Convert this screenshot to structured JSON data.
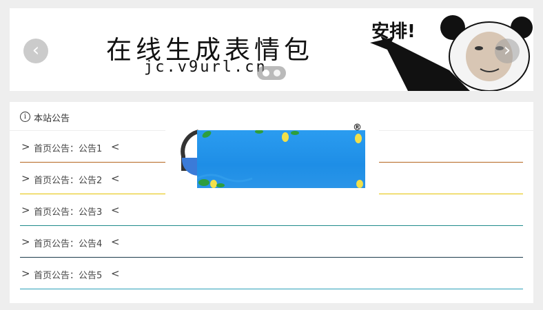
{
  "banner": {
    "title": "在线生成表情包",
    "url": "jc.v9url.cn",
    "meme_text": "安排!",
    "prev_label": "‹",
    "next_label": "›"
  },
  "notice": {
    "title": "本站公告",
    "items": [
      {
        "label": "首页公告：公告1",
        "color": "#b5651d"
      },
      {
        "label": "首页公告：公告2",
        "color": "#e6c200"
      },
      {
        "label": "首页公告：公告3",
        "color": "#1e8a8a"
      },
      {
        "label": "首页公告：公告4",
        "color": "#1a3a4a"
      },
      {
        "label": "首页公告：公告5",
        "color": "#2aa0b8"
      }
    ]
  },
  "ad": {
    "reg_mark": "®"
  }
}
